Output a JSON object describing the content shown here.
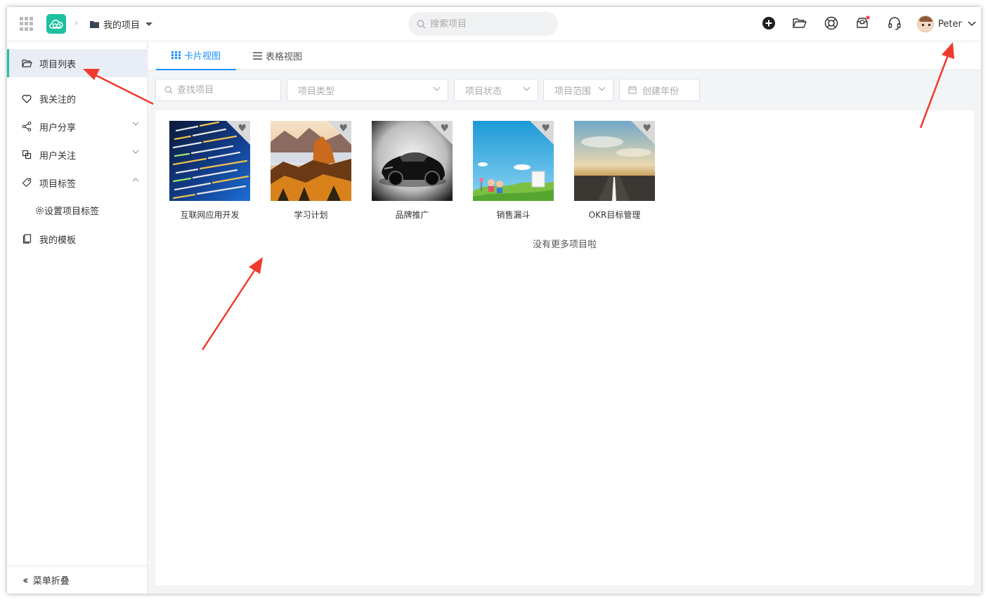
{
  "header": {
    "project_menu_label": "我的项目",
    "search_placeholder": "搜索项目",
    "user_name": "Peter"
  },
  "sidebar": {
    "items": [
      {
        "label": "项目列表",
        "icon": "folder-open-icon",
        "active": true
      },
      {
        "label": "我关注的",
        "icon": "heart-outline-icon"
      },
      {
        "label": "用户分享",
        "icon": "share-icon",
        "expand": "down"
      },
      {
        "label": "用户关注",
        "icon": "copy-icon",
        "expand": "down"
      },
      {
        "label": "项目标签",
        "icon": "tag-icon",
        "expand": "up"
      },
      {
        "label": "我的模板",
        "icon": "template-icon"
      }
    ],
    "sub_item": "设置项目标签",
    "collapse_label": "菜单折叠"
  },
  "tabs": [
    {
      "label": "卡片视图",
      "icon": "grid-icon",
      "active": true
    },
    {
      "label": "表格视图",
      "icon": "list-icon",
      "active": false
    }
  ],
  "filters": {
    "search_placeholder": "查找项目",
    "type_placeholder": "项目类型",
    "status_placeholder": "项目状态",
    "scope_placeholder": "项目范围",
    "year_placeholder": "创建年份"
  },
  "projects": [
    {
      "name": "互联网应用开发",
      "image": "code-screen"
    },
    {
      "name": "学习计划",
      "image": "mountain-landscape"
    },
    {
      "name": "品牌推广",
      "image": "black-sports-car"
    },
    {
      "name": "销售漏斗",
      "image": "cartoon-kids"
    },
    {
      "name": "OKR目标管理",
      "image": "open-road"
    }
  ],
  "empty_hint": "没有更多项目啦",
  "colors": {
    "brand": "#1ec0a0",
    "tab_active": "#1890ff",
    "annotation_arrow": "#f03a2e"
  }
}
